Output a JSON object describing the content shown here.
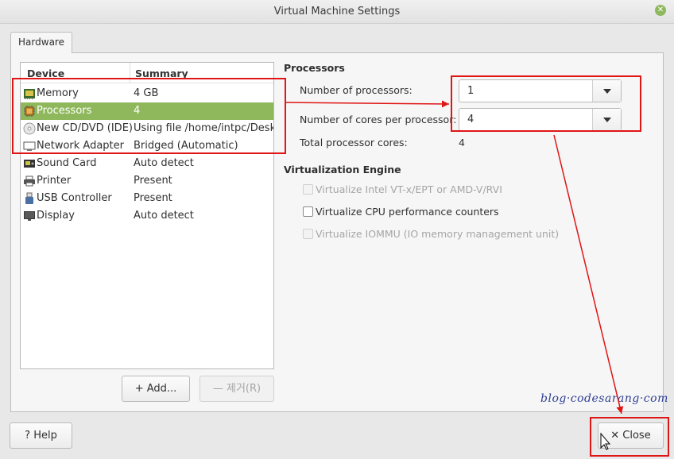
{
  "window": {
    "title": "Virtual Machine Settings"
  },
  "tabs": [
    {
      "label": "Hardware"
    }
  ],
  "device_list": {
    "columns": {
      "device": "Device",
      "summary": "Summary"
    },
    "rows": [
      {
        "name": "Memory",
        "summary": "4 GB",
        "icon": "memory-icon"
      },
      {
        "name": "Processors",
        "summary": "4",
        "icon": "processor-icon"
      },
      {
        "name": "New CD/DVD (IDE)",
        "summary": "Using file /home/intpc/Deskto",
        "icon": "cd-dvd-icon"
      },
      {
        "name": "Network Adapter",
        "summary": "Bridged (Automatic)",
        "icon": "network-adapter-icon"
      },
      {
        "name": "Sound Card",
        "summary": "Auto detect",
        "icon": "sound-card-icon"
      },
      {
        "name": "Printer",
        "summary": "Present",
        "icon": "printer-icon"
      },
      {
        "name": "USB Controller",
        "summary": "Present",
        "icon": "usb-icon"
      },
      {
        "name": "Display",
        "summary": "Auto detect",
        "icon": "display-icon"
      }
    ],
    "selected": "Processors",
    "add_label": "+ Add...",
    "remove_label": "— 제거(R)"
  },
  "processors": {
    "heading": "Processors",
    "num_processors_label": "Number of processors:",
    "num_processors_value": "1",
    "cores_label": "Number of cores per processor:",
    "cores_value": "4",
    "total_label": "Total processor cores:",
    "total_value": "4"
  },
  "virtualization": {
    "heading": "Virtualization Engine",
    "options": [
      {
        "label": "Virtualize Intel VT-x/EPT or AMD-V/RVI",
        "checked": false,
        "enabled": false
      },
      {
        "label": "Virtualize CPU performance counters",
        "checked": false,
        "enabled": true
      },
      {
        "label": "Virtualize IOMMU (IO memory management unit)",
        "checked": false,
        "enabled": false
      }
    ]
  },
  "footer": {
    "help_label": "? Help",
    "close_label": "✕ Close"
  },
  "watermark": "blog·codesarang·com",
  "colors": {
    "selection": "#8fb85d",
    "annotation": "#e01515",
    "watermark": "#2f3f95"
  }
}
